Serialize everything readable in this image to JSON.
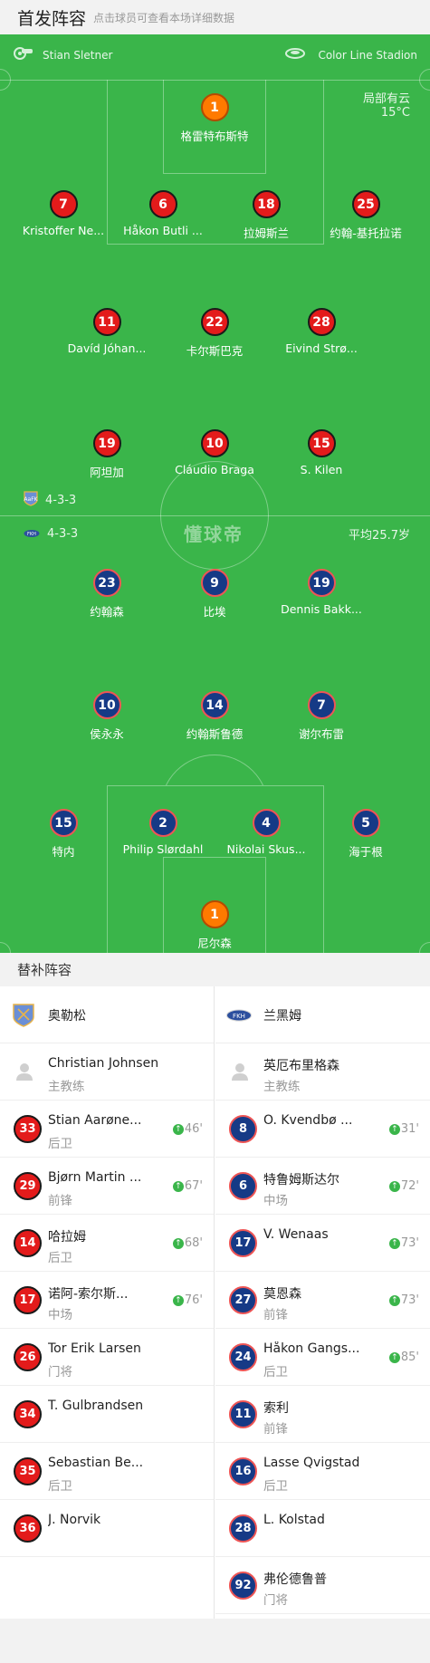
{
  "header": {
    "title": "首发阵容",
    "hint": "点击球员可查看本场详细数据"
  },
  "match": {
    "referee": "Stian Sletner",
    "stadium": "Color Line Stadion",
    "weather": "局部有云",
    "temperature": "15°C",
    "watermark": "懂球帝"
  },
  "home": {
    "formation": "4-3-3",
    "players": [
      {
        "num": "1",
        "name": "格雷特布斯特",
        "kind": "gk"
      },
      {
        "num": "7",
        "name": "Kristoffer Ne...",
        "yellow": true
      },
      {
        "num": "6",
        "name": "Håkon Butli ..."
      },
      {
        "num": "18",
        "name": "拉姆斯兰",
        "yellow": true
      },
      {
        "num": "25",
        "name": "约翰-基托拉诺",
        "sub": "46'"
      },
      {
        "num": "11",
        "name": "Davíd Jóhan...",
        "sub": "67'"
      },
      {
        "num": "22",
        "name": "卡尔斯巴克"
      },
      {
        "num": "28",
        "name": "Eivind Strø..."
      },
      {
        "num": "19",
        "name": "阿坦加",
        "sub": "68'"
      },
      {
        "num": "10",
        "name": "Cláudio Braga"
      },
      {
        "num": "15",
        "name": "S. Kilen",
        "sub": "76'",
        "goal": true
      }
    ]
  },
  "away": {
    "formation": "4-3-3",
    "avg_age": "平均25.7岁",
    "players": [
      {
        "num": "23",
        "name": "约翰森",
        "sub": "73'"
      },
      {
        "num": "9",
        "name": "比埃",
        "sub": "73'",
        "goal": true
      },
      {
        "num": "19",
        "name": "Dennis Bakk..."
      },
      {
        "num": "10",
        "name": "侯永永",
        "goal": true
      },
      {
        "num": "14",
        "name": "约翰斯鲁德"
      },
      {
        "num": "7",
        "name": "谢尔布雷",
        "sub": "31'"
      },
      {
        "num": "15",
        "name": "特内",
        "sub": "85'"
      },
      {
        "num": "2",
        "name": "Philip Slørdahl",
        "sub": "72'"
      },
      {
        "num": "4",
        "name": "Nikolai Skus..."
      },
      {
        "num": "5",
        "name": "海于根"
      },
      {
        "num": "1",
        "name": "尼尔森",
        "kind": "gk"
      }
    ]
  },
  "subs_title": "替补阵容",
  "bench": {
    "left": {
      "team": "奥勒松",
      "coach": {
        "name": "Christian Johnsen",
        "role": "主教练"
      },
      "players": [
        {
          "num": "33",
          "name": "Stian Aarøne...",
          "pos": "后卫",
          "time": "46'"
        },
        {
          "num": "29",
          "name": "Bjørn Martin ...",
          "pos": "前锋",
          "time": "67'"
        },
        {
          "num": "14",
          "name": "哈拉姆",
          "pos": "后卫",
          "time": "68'"
        },
        {
          "num": "17",
          "name": "诺阿-索尔斯...",
          "pos": "中场",
          "time": "76'"
        },
        {
          "num": "26",
          "name": "Tor Erik Larsen",
          "pos": "门将"
        },
        {
          "num": "34",
          "name": "T. Gulbrandsen",
          "pos": ""
        },
        {
          "num": "35",
          "name": "Sebastian Be...",
          "pos": "后卫"
        },
        {
          "num": "36",
          "name": "J. Norvik",
          "pos": ""
        }
      ]
    },
    "right": {
      "team": "兰黑姆",
      "coach": {
        "name": "英厄布里格森",
        "role": "主教练"
      },
      "players": [
        {
          "num": "8",
          "name": "O. Kvendbø ...",
          "pos": "",
          "time": "31'"
        },
        {
          "num": "6",
          "name": "特鲁姆斯达尔",
          "pos": "中场",
          "time": "72'"
        },
        {
          "num": "17",
          "name": "V. Wenaas",
          "pos": "",
          "time": "73'"
        },
        {
          "num": "27",
          "name": "莫恩森",
          "pos": "前锋",
          "time": "73'"
        },
        {
          "num": "24",
          "name": "Håkon Gangs...",
          "pos": "后卫",
          "time": "85'"
        },
        {
          "num": "11",
          "name": "索利",
          "pos": "前锋"
        },
        {
          "num": "16",
          "name": "Lasse Qvigstad",
          "pos": "后卫"
        },
        {
          "num": "28",
          "name": "L. Kolstad",
          "pos": ""
        },
        {
          "num": "92",
          "name": "弗伦德鲁普",
          "pos": "门将"
        }
      ]
    }
  },
  "colors": {
    "pitch": "#3ab54a",
    "home": "#e31b1b",
    "away": "#163a86",
    "keeper": "#ff7a00"
  }
}
